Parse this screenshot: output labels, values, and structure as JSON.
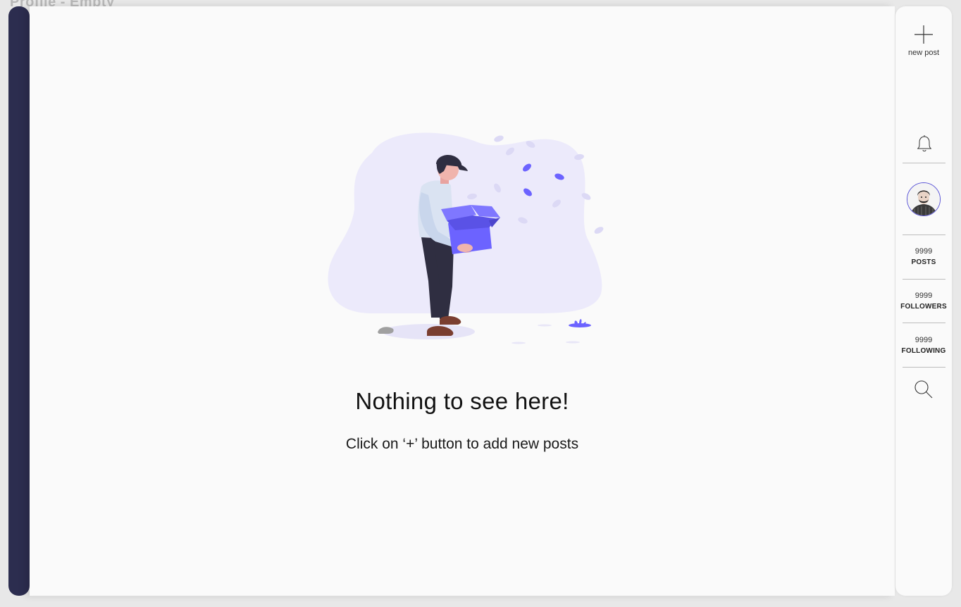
{
  "frame": {
    "title": "Profile - Empty"
  },
  "empty_state": {
    "title": "Nothing to see here!",
    "subtitle": "Click on ‘+’ button to add new posts"
  },
  "sidebar": {
    "new_post": {
      "label": "new post",
      "icon": "plus-icon"
    },
    "notifications": {
      "icon": "bell-icon"
    },
    "profile": {
      "icon": "avatar"
    },
    "stats": [
      {
        "value": "9999",
        "label": "POSTS"
      },
      {
        "value": "9999",
        "label": "FOLLOWERS"
      },
      {
        "value": "9999",
        "label": "FOLLOWING"
      }
    ],
    "search": {
      "icon": "search-icon"
    }
  },
  "colors": {
    "rail": "#2c2d4f",
    "accent": "#6c63ff",
    "blob": "#eceafb",
    "background": "#fafafa"
  }
}
